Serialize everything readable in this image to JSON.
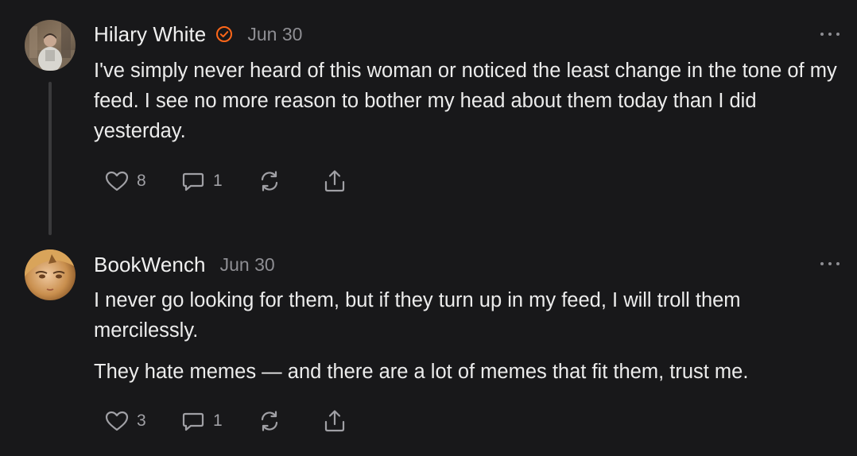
{
  "comments": [
    {
      "author": "Hilary White",
      "verified": true,
      "date": "Jun 30",
      "paragraphs": [
        "I've simply never heard of this woman or noticed the least change in the tone of my feed. I see no more reason to bother my head about them today than I did yesterday."
      ],
      "likes": "8",
      "replies": "1"
    },
    {
      "author": "BookWench",
      "verified": false,
      "date": "Jun 30",
      "paragraphs": [
        "I never go looking for them, but if they turn up in my feed, I will troll them mercilessly.",
        "They hate memes — and there are a lot of memes that fit them, trust me."
      ],
      "likes": "3",
      "replies": "1"
    }
  ],
  "colors": {
    "background": "#18181a",
    "verified_badge": "#ff6719",
    "muted": "#8e8e93"
  },
  "icons": [
    "heart-icon",
    "comment-icon",
    "restack-icon",
    "share-icon",
    "more-icon",
    "verified-icon"
  ]
}
